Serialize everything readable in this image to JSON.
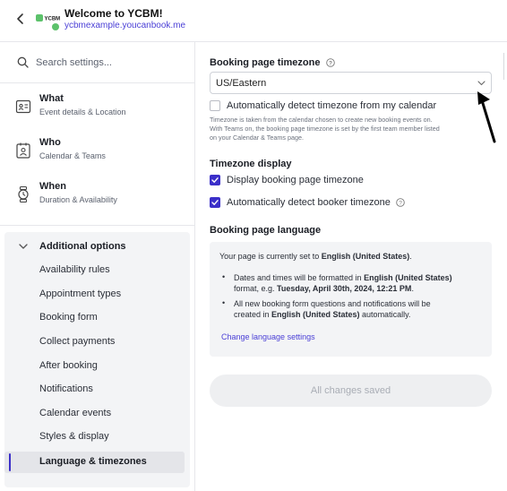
{
  "header": {
    "title": "Welcome to YCBM!",
    "link": "ycbmexample.youcanbook.me",
    "logo_text": "YCBM"
  },
  "sidebar": {
    "search_placeholder": "Search settings...",
    "nav": [
      {
        "title": "What",
        "subtitle": "Event details & Location",
        "icon": "id-card-icon"
      },
      {
        "title": "Who",
        "subtitle": "Calendar & Teams",
        "icon": "contact-icon"
      },
      {
        "title": "When",
        "subtitle": "Duration & Availability",
        "icon": "watch-icon"
      }
    ],
    "options_title": "Additional options",
    "options": [
      "Availability rules",
      "Appointment types",
      "Booking form",
      "Collect payments",
      "After booking",
      "Notifications",
      "Calendar events",
      "Styles & display",
      "Language & timezones"
    ],
    "active_option": "Language & timezones"
  },
  "main": {
    "tz_label": "Booking page timezone",
    "tz_value": "US/Eastern",
    "auto_detect_label": "Automatically detect timezone from my calendar",
    "auto_detect_checked": false,
    "hint_line1": "Timezone is taken from the calendar chosen to create new booking events on.",
    "hint_line2": "With Teams on, the booking page timezone is set by the first team member listed",
    "hint_line3": "on your Calendar & Teams page.",
    "display_label": "Timezone display",
    "display_page_tz": "Display booking page timezone",
    "display_page_tz_checked": true,
    "detect_booker_tz": "Automatically detect booker timezone",
    "detect_booker_tz_checked": true,
    "lang_label": "Booking page language",
    "lang_prefix": "Your page is currently set to ",
    "lang_value": "English (United States)",
    "lang_suffix": ".",
    "bullet1_a": "Dates and times will be formatted in ",
    "bullet1_b": "English (United States)",
    "bullet1_c": "format, e.g. ",
    "bullet1_d": "Tuesday, April 30th, 2024, 12:21 PM",
    "bullet1_e": ".",
    "bullet2_a": "All new booking form questions and notifications will be",
    "bullet2_b": "created in ",
    "bullet2_c": "English (United States)",
    "bullet2_d": " automatically.",
    "change_link": "Change language settings",
    "save_label": "All changes saved"
  },
  "colors": {
    "accent": "#3b2fc9",
    "link": "#4a3fd6",
    "logo_green": "#5cc26b"
  }
}
